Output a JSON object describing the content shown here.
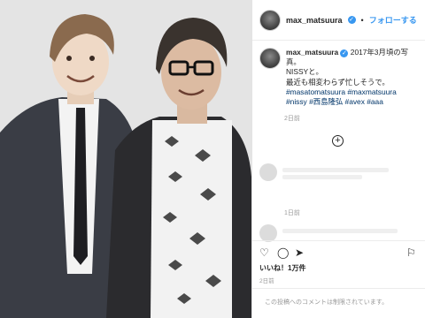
{
  "post": {
    "username": "max_matsuura",
    "follow_label": "フォローする",
    "caption_user": "max_matsuura",
    "caption_lines": [
      "2017年3月頃の写",
      "真。",
      "NISSYと。",
      "最近も相変わらず忙しそうで。"
    ],
    "hashtag_lines": [
      "#masatomatsuura #maxmatsuura",
      "#nissy #西島隆弘 #avex #aaa"
    ],
    "caption_age": "2日前",
    "comment_age": "1日前",
    "likes_label": "いいね！1万件",
    "post_date": "2日前",
    "comments_limited": "この投稿へのコメントは制限されています。"
  },
  "icons": {
    "verified": "verified-badge-icon",
    "load_more": "plus-circle-icon",
    "like": "heart-icon",
    "comment": "comment-icon",
    "share": "share-icon",
    "save": "bookmark-icon"
  },
  "colors": {
    "accent": "#3897f0",
    "hashtag": "#003569",
    "muted": "#999999"
  }
}
